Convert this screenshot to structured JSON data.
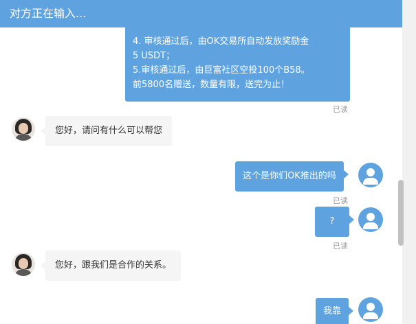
{
  "header": {
    "title": "对方正在输入..."
  },
  "announcement": {
    "lines": [
      "4. 审核通过后，由OK交易所自动发放奖励金",
      "5 USDT；",
      "5.审核通过后，由巨富社区空投100个B58。",
      "前5800名赠送，数量有限，送完为止！"
    ],
    "read_label": "已读"
  },
  "messages": [
    {
      "from": "agent",
      "text": "您好，请问有什么可以帮您"
    },
    {
      "from": "user",
      "text": "这个是你们OK推出的吗",
      "status": "已读"
    },
    {
      "from": "user",
      "text": "?",
      "status": "已读"
    },
    {
      "from": "agent",
      "text": "您好，跟我们是合作的关系。"
    },
    {
      "from": "user",
      "text": "我靠"
    }
  ],
  "colors": {
    "accent": "#5ea3e0",
    "incoming_bubble": "#f5f5f5",
    "read_text": "#999999"
  }
}
